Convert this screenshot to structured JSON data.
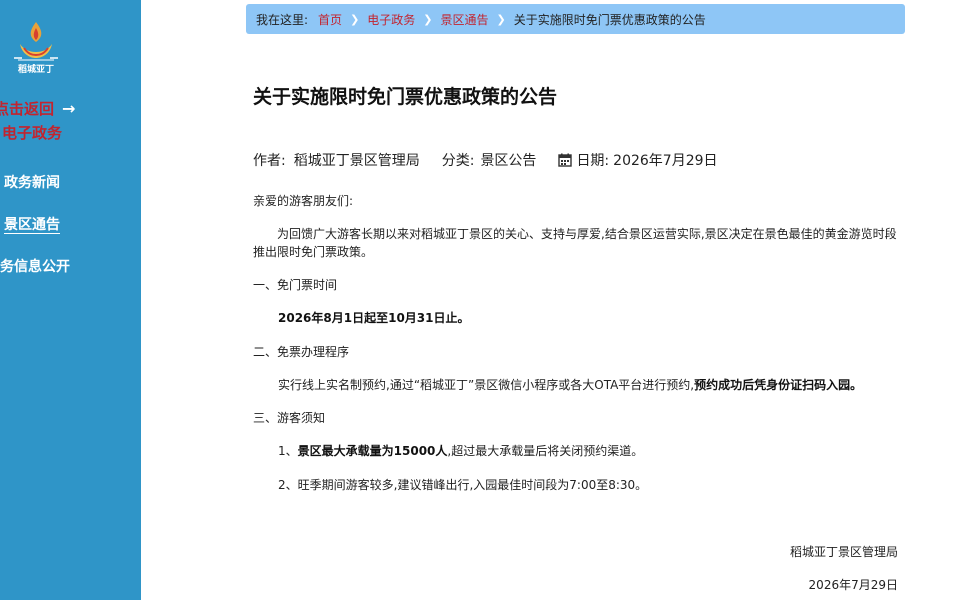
{
  "sidebar": {
    "logo_text": "稻城亚丁",
    "back_label": "点击返回",
    "section_label": "电子政务",
    "nav_items": [
      {
        "label": "政务新闻"
      },
      {
        "label": "景区通告"
      },
      {
        "label": "政务信息公开"
      }
    ]
  },
  "breadcrumb": {
    "prefix": "我在这里:",
    "items": [
      {
        "label": "首页"
      },
      {
        "label": "电子政务"
      },
      {
        "label": "景区通告"
      }
    ],
    "current": "关于实施限时免门票优惠政策的公告"
  },
  "article": {
    "title": "关于实施限时免门票优惠政策的公告",
    "author_label": "作者:",
    "author": "稻城亚丁景区管理局",
    "category_label": "分类:",
    "category": "景区公告",
    "date_label": "日期:",
    "date": "2026年7月29日",
    "greeting": "亲爱的游客朋友们:",
    "intro": "为回馈广大游客长期以来对稻城亚丁景区的关心、支持与厚爱,结合景区运营实际,景区决定在景色最佳的黄金游览时段推出限时免门票政策。",
    "section1_title": "一、免门票时间",
    "section1_body": "2026年8月1日起至10月31日止。",
    "section2_title": "二、免票办理程序",
    "section2_body_normal": "实行线上实名制预约,通过“稻城亚丁”景区微信小程序或各大OTA平台进行预约,",
    "section2_body_bold": "预约成功后凭身份证扫码入园。",
    "section3_title": "三、游客须知",
    "notice1_prefix": "1、",
    "notice1_bold": "景区最大承载量为15000人",
    "notice1_rest": ",超过最大承载量后将关闭预约渠道。",
    "notice2": "2、旺季期间游客较多,建议错峰出行,入园最佳时间段为7:00至8:30。",
    "signature": "稻城亚丁景区管理局",
    "signature_date": "2026年7月29日"
  },
  "colors": {
    "sidebar_bg": "#2f95c8",
    "accent_red": "#c2242f",
    "breadcrumb_bg": "#8ec6f6"
  },
  "icons": [
    "logo-emblem",
    "arrow-right-icon",
    "calendar-icon",
    "chevron-right-icon"
  ]
}
